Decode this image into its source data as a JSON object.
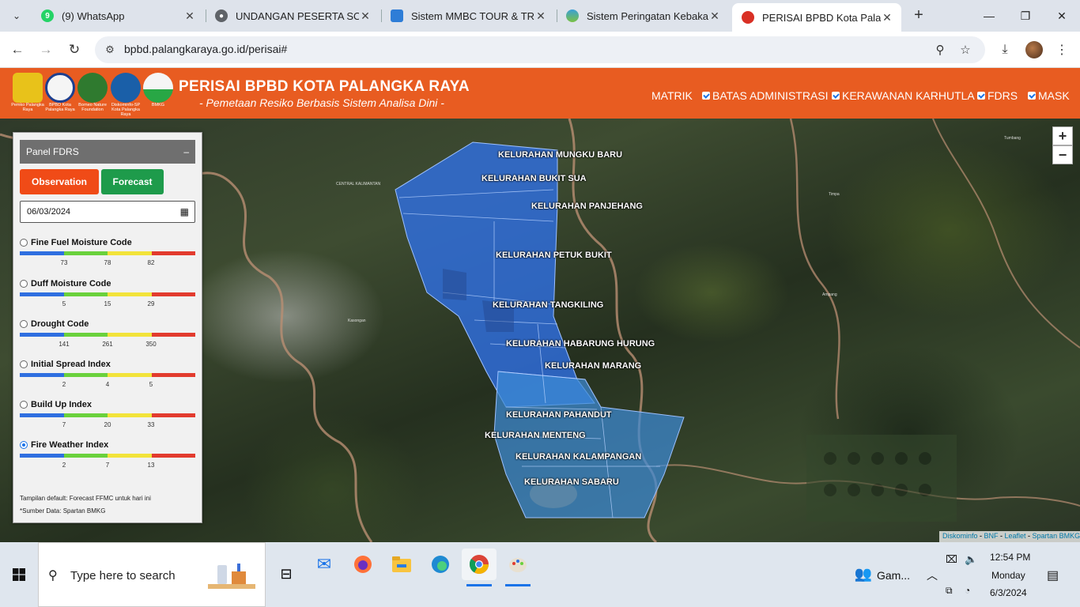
{
  "browser": {
    "tabs": [
      {
        "title": "(9) WhatsApp",
        "favicon_color": "#25d366",
        "favicon_glyph": "9",
        "active": false
      },
      {
        "title": "UNDANGAN PESERTA SOS T",
        "favicon_color": "#5f6368",
        "favicon_glyph": "globe-icon",
        "active": false
      },
      {
        "title": "Sistem MMBC TOUR & TRAV",
        "favicon_color": "#2e7dd7",
        "favicon_glyph": "",
        "active": false
      },
      {
        "title": "Sistem Peringatan Kebakaran",
        "favicon_color": "#3aa0d8",
        "favicon_glyph": "",
        "active": false
      },
      {
        "title": "PERISAI BPBD Kota Palangka",
        "favicon_color": "#d93025",
        "favicon_glyph": "",
        "active": true
      }
    ],
    "url": "bpbd.palangkaraya.go.id/perisai#"
  },
  "site": {
    "logos": [
      {
        "caption": "Pemko Palangka Raya",
        "color": "#e8c21a"
      },
      {
        "caption": "BPBD Kota Palangka Raya",
        "color": "#1d3f8f"
      },
      {
        "caption": "Borneo Nature Foundation",
        "color": "#2f7a2f"
      },
      {
        "caption": "Diskominfo-SP Kota Palangka Raya",
        "color": "#1a5fa8"
      },
      {
        "caption": "BMKG",
        "color": "#28a745"
      }
    ],
    "title": "PERISAI BPBD KOTA PALANGKA RAYA",
    "subtitle": "- Pemetaan Resiko Berbasis Sistem Analisa Dini -",
    "nav": {
      "matrik": "MATRIK",
      "batas": "BATAS ADMINISTRASI",
      "kerawanan": "KERAWANAN KARHUTLA",
      "fdrs": "FDRS",
      "mask": "MASK"
    }
  },
  "panel": {
    "title": "Panel FDRS",
    "minimize": "–",
    "observation_label": "Observation",
    "forecast_label": "Forecast",
    "date_value": "06/03/2024",
    "indices": [
      {
        "name": "Fine Fuel Moisture Code",
        "ticks": [
          "73",
          "78",
          "82"
        ],
        "selected": false
      },
      {
        "name": "Duff Moisture Code",
        "ticks": [
          "5",
          "15",
          "29"
        ],
        "selected": false
      },
      {
        "name": "Drought Code",
        "ticks": [
          "141",
          "261",
          "350"
        ],
        "selected": false
      },
      {
        "name": "Initial Spread Index",
        "ticks": [
          "2",
          "4",
          "5"
        ],
        "selected": false
      },
      {
        "name": "Build Up Index",
        "ticks": [
          "7",
          "20",
          "33"
        ],
        "selected": false
      },
      {
        "name": "Fire Weather Index",
        "ticks": [
          "2",
          "7",
          "13"
        ],
        "selected": true
      }
    ],
    "scale_colors": [
      "#2f6fe0",
      "#6ad13c",
      "#f2e33a",
      "#e23b2e"
    ],
    "note_default": "Tampilan default: Forecast FFMC untuk hari ini",
    "note_source": "*Sumber Data: Spartan BMKG"
  },
  "map": {
    "kelurahan": [
      "KELURAHAN MUNGKU BARU",
      "KELURAHAN BUKIT SUA",
      "KELURAHAN PANJEHANG",
      "KELURAHAN PETUK BUKIT",
      "KELURAHAN TANGKILING",
      "KELURAHAN HABARUNG HURUNG",
      "KELURAHAN MARANG",
      "KELURAHAN PAHANDUT",
      "KELURAHAN MENTENG",
      "KELURAHAN KALAMPANGAN",
      "KELURAHAN SABARU"
    ],
    "small_labels": [
      "CENTRAL KALIMANTAN",
      "Timpa",
      "Tumbang",
      "Ampang",
      "Kasongan"
    ],
    "zoom_in": "+",
    "zoom_out": "−",
    "attribution": {
      "diskominfo": "Diskominfo",
      "bnf": "BNF",
      "leaflet": "Leaflet",
      "spartan": "Spartan BMKG",
      "sep": " - "
    }
  },
  "taskbar": {
    "search_placeholder": "Type here to search",
    "game_label": "Gam...",
    "time": "12:54 PM",
    "day": "Monday",
    "date": "6/3/2024"
  }
}
